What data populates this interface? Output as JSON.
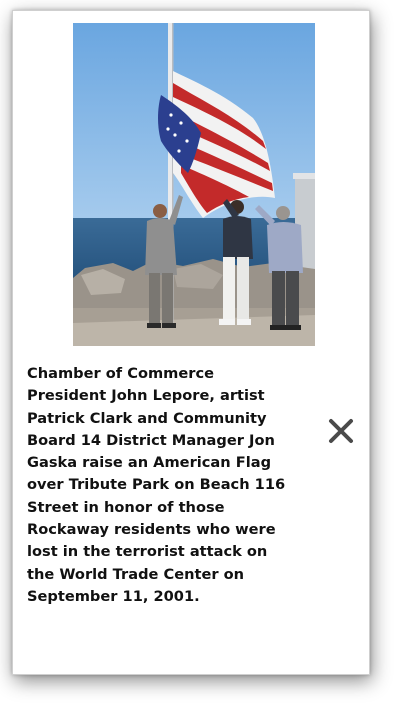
{
  "popup": {
    "photo": {
      "alt": "Raising an American flag at Tribute Park"
    },
    "caption": "Chamber of Commerce President John Lepore, artist Patrick Clark and Community Board 14 District Manager Jon Gaska raise an American Flag over Tribute Park on Beach 116 Street in honor of those Rockaway residents who were lost in the terrorist attack on the World Trade Center on September 11, 2001.",
    "close_icon": "close-icon"
  },
  "colors": {
    "sky": "#7fb6e6",
    "water": "#2d5f8e",
    "caption_text": "#111111",
    "close_icon": "#4a4a4a"
  }
}
